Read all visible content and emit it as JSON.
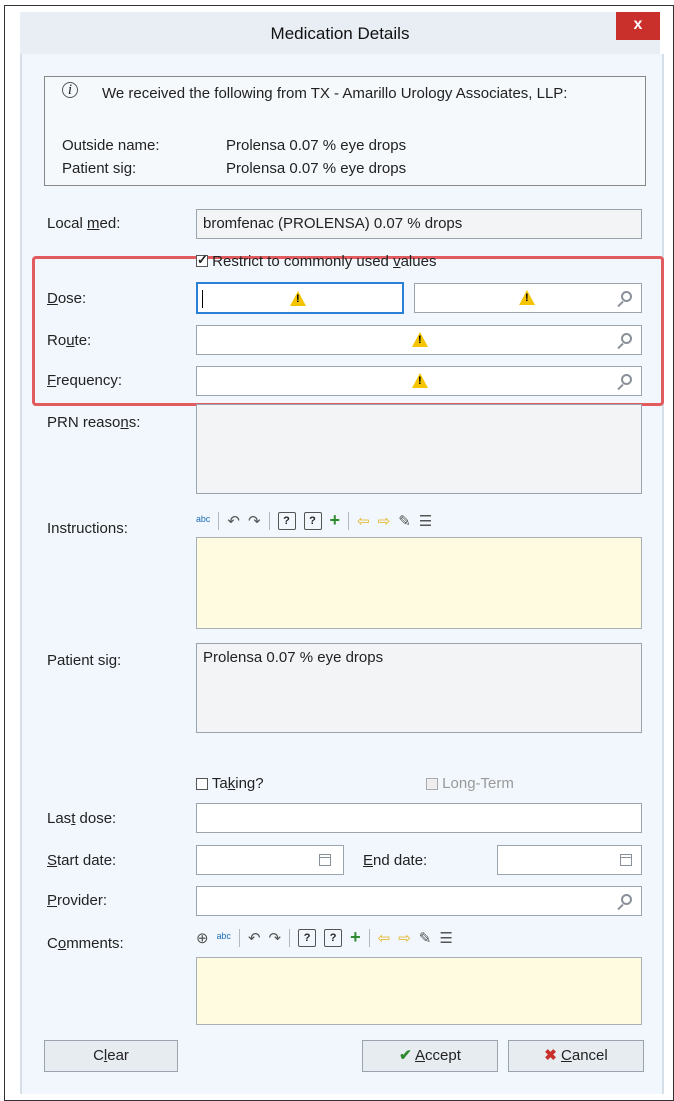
{
  "window": {
    "title": "Medication Details",
    "close_label": "x"
  },
  "info": {
    "message": "We received the following from TX - Amarillo Urology Associates, LLP:",
    "outside_name_label": "Outside name:",
    "outside_name_value": "Prolensa 0.07 % eye drops",
    "patient_sig_label": "Patient sig:",
    "patient_sig_value": "Prolensa 0.07 % eye drops"
  },
  "local_med": {
    "label_pre": "Local ",
    "label_ul": "m",
    "label_post": "ed:",
    "value": "bromfenac (PROLENSA) 0.07 % drops"
  },
  "restrict": {
    "pre": "Restrict to commonly used ",
    "ul": "v",
    "post": "alues",
    "checked": true
  },
  "dose": {
    "label_ul": "D",
    "label_post": "ose:"
  },
  "route": {
    "label_pre": "Ro",
    "label_ul": "u",
    "label_post": "te:"
  },
  "frequency": {
    "label_ul": "F",
    "label_post": "requency:"
  },
  "prn": {
    "label_pre": "PRN reaso",
    "label_ul": "n",
    "label_post": "s:"
  },
  "instructions": {
    "label": "Instructions:"
  },
  "patient_sig": {
    "label": "Patient sig:",
    "value": "Prolensa 0.07 % eye drops"
  },
  "taking": {
    "pre": "Ta",
    "ul": "k",
    "post": "ing?"
  },
  "long_term": {
    "label": "Long-Term"
  },
  "last_dose": {
    "pre": "Las",
    "ul": "t",
    "post": " dose:"
  },
  "start_date": {
    "ul": "S",
    "post": "tart date:"
  },
  "end_date": {
    "ul": "E",
    "post": "nd date:"
  },
  "provider": {
    "ul": "P",
    "post": "rovider:"
  },
  "comments": {
    "pre": "C",
    "ul": "o",
    "post": "mments:"
  },
  "buttons": {
    "clear_pre": "C",
    "clear_ul": "l",
    "clear_post": "ear",
    "accept_ul": "A",
    "accept_post": "ccept",
    "cancel_ul": "C",
    "cancel_post": "ancel"
  },
  "toolbar_glyphs": {
    "spell": "ᵃᵇᶜ",
    "undo": "↶",
    "redo": "↷",
    "help1": "?",
    "help2": "?",
    "add": "+",
    "left": "⇦",
    "right": "⇨",
    "zoom": "⊕"
  },
  "colors": {
    "highlight_border": "#e15b5f",
    "warning": "#f5c400",
    "close": "#c9302c"
  }
}
